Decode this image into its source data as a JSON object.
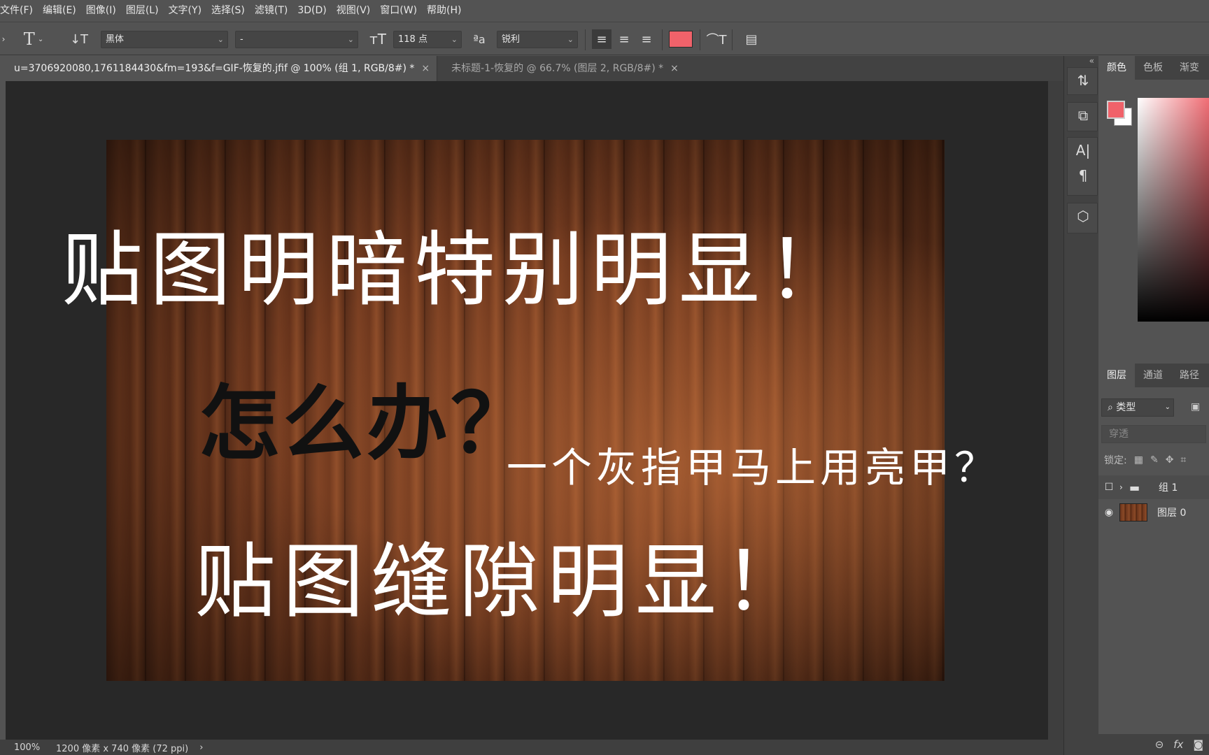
{
  "menu": [
    "文件(F)",
    "编辑(E)",
    "图像(I)",
    "图层(L)",
    "文字(Y)",
    "选择(S)",
    "滤镜(T)",
    "3D(D)",
    "视图(V)",
    "窗口(W)",
    "帮助(H)"
  ],
  "options": {
    "font_family": "黑体",
    "font_style": "-",
    "font_size": "118 点",
    "antialias": "锐利",
    "text_color": "#f0626a"
  },
  "tabs": [
    {
      "title": "u=3706920080,1761184430&fm=193&f=GIF-恢复的.jfif @ 100% (组 1, RGB/8#) *",
      "close": "×"
    },
    {
      "title": "未标题-1-恢复的 @ 66.7% (图层 2, RGB/8#) *",
      "close": "×"
    }
  ],
  "canvas_text": {
    "line1": "贴图明暗特别明显！",
    "line2": "怎么办？",
    "line3": "一个灰指甲马上用亮甲？",
    "line4": "贴图缝隙明显！"
  },
  "status": {
    "zoom": "100%",
    "doc_size": "1200 像素 x 740 像素 (72 ppi)",
    "arrow": "›"
  },
  "color_panel": {
    "tabs": [
      "颜色",
      "色板",
      "渐变"
    ],
    "foreground": "#f0626a",
    "background": "#ffffff"
  },
  "layers_panel": {
    "tabs": [
      "图层",
      "通道",
      "路径"
    ],
    "filter_label": "类型",
    "blend_mode": "穿透",
    "lock_label": "锁定:",
    "layers": [
      {
        "name": "组 1",
        "visible": false,
        "type": "group"
      },
      {
        "name": "图层 0",
        "visible": true,
        "type": "image"
      }
    ],
    "fx_label": "fx"
  }
}
